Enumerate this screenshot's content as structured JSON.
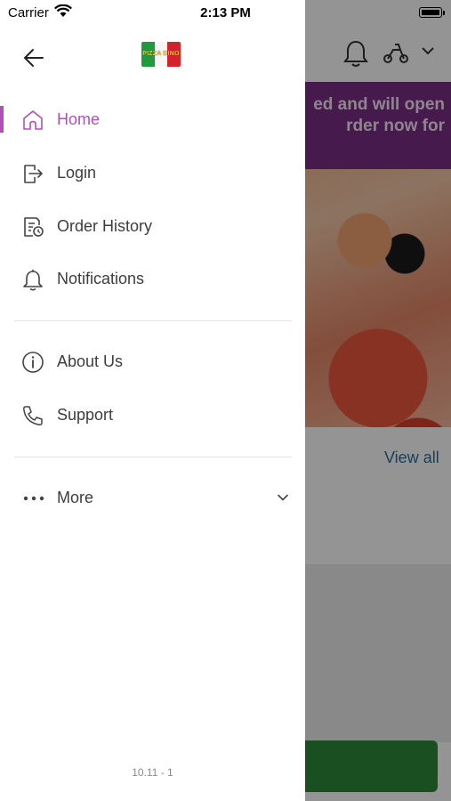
{
  "status_bar": {
    "carrier": "Carrier",
    "time": "2:13 PM"
  },
  "background": {
    "banner_text": "ed and will open\nrder now for",
    "view_all": "View all"
  },
  "drawer": {
    "logo_text": "PIZZA DINO",
    "menu": [
      {
        "label": "Home",
        "icon": "home-icon",
        "active": true
      },
      {
        "label": "Login",
        "icon": "login-icon",
        "active": false
      },
      {
        "label": "Order History",
        "icon": "order-history-icon",
        "active": false
      },
      {
        "label": "Notifications",
        "icon": "bell-icon",
        "active": false
      },
      {
        "label": "About Us",
        "icon": "info-icon",
        "active": false
      },
      {
        "label": "Support",
        "icon": "phone-icon",
        "active": false
      },
      {
        "label": "More",
        "icon": "more-dots-icon",
        "active": false
      }
    ],
    "version": "10.11 - 1"
  },
  "colors": {
    "accent": "#b04fb8",
    "banner": "#7b2e86",
    "link": "#2a6f9b",
    "cta": "#2e8b3a"
  }
}
